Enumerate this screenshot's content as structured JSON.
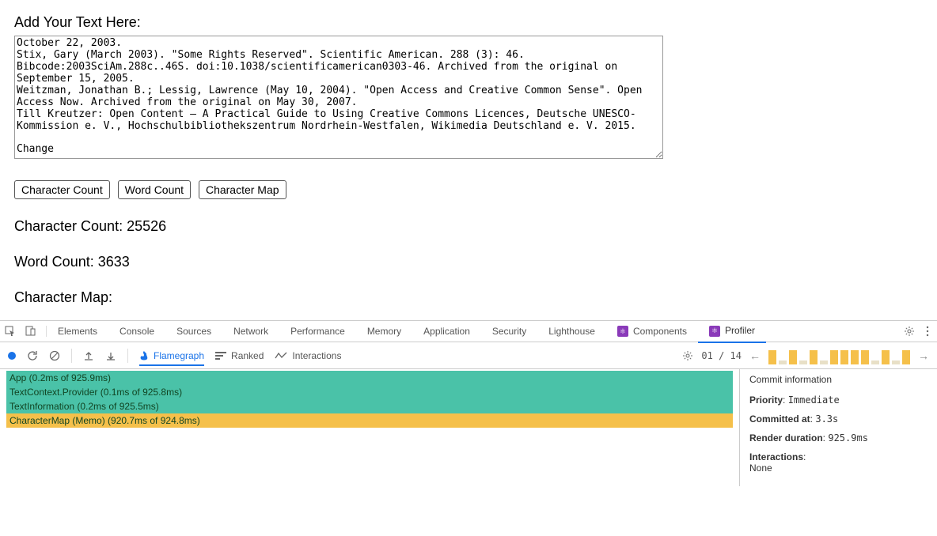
{
  "page": {
    "heading": "Add Your Text Here:",
    "textarea_value": "October 22, 2003.\nStix, Gary (March 2003). \"Some Rights Reserved\". Scientific American. 288 (3): 46.\nBibcode:2003SciAm.288c..46S. doi:10.1038/scientificamerican0303-46. Archived from the original on September 15, 2005.\nWeitzman, Jonathan B.; Lessig, Lawrence (May 10, 2004). \"Open Access and Creative Common Sense\". Open Access Now. Archived from the original on May 30, 2007.\nTill Kreutzer: Open Content – A Practical Guide to Using Creative Commons Licences, Deutsche UNESCO-Kommission e. V., Hochschulbibliothekszentrum Nordrhein-Westfalen, Wikimedia Deutschland e. V. 2015.\n\nChange",
    "buttons": {
      "char_count": "Character Count",
      "word_count": "Word Count",
      "char_map": "Character Map"
    },
    "stats": {
      "char_count_label": "Character Count: 25526",
      "word_count_label": "Word Count: 3633",
      "char_map_label": "Character Map:"
    }
  },
  "devtools": {
    "tabs": {
      "elements": "Elements",
      "console": "Console",
      "sources": "Sources",
      "network": "Network",
      "performance": "Performance",
      "memory": "Memory",
      "application": "Application",
      "security": "Security",
      "lighthouse": "Lighthouse",
      "components": "Components",
      "profiler": "Profiler"
    },
    "profiler": {
      "modes": {
        "flamegraph": "Flamegraph",
        "ranked": "Ranked",
        "interactions": "Interactions"
      },
      "commit_position": "01 / 14",
      "commit_bars": [
        {
          "variant": "big"
        },
        {
          "variant": "small"
        },
        {
          "variant": "big"
        },
        {
          "variant": "small"
        },
        {
          "variant": "big"
        },
        {
          "variant": "small"
        },
        {
          "variant": "big"
        },
        {
          "variant": "big"
        },
        {
          "variant": "big"
        },
        {
          "variant": "big"
        },
        {
          "variant": "small"
        },
        {
          "variant": "big"
        },
        {
          "variant": "small"
        },
        {
          "variant": "big"
        }
      ],
      "flame_rows": [
        {
          "label": "App (0.2ms of 925.9ms)",
          "color": "teal"
        },
        {
          "label": "TextContext.Provider (0.1ms of 925.8ms)",
          "color": "teal"
        },
        {
          "label": "TextInformation (0.2ms of 925.5ms)",
          "color": "teal"
        },
        {
          "label": "CharacterMap (Memo) (920.7ms of 924.8ms)",
          "color": "yellow"
        }
      ],
      "info": {
        "title": "Commit information",
        "priority_label": "Priority",
        "priority_value": "Immediate",
        "committed_label": "Committed at",
        "committed_value": "3.3s",
        "duration_label": "Render duration",
        "duration_value": "925.9ms",
        "interactions_label": "Interactions",
        "interactions_value": "None"
      }
    }
  }
}
